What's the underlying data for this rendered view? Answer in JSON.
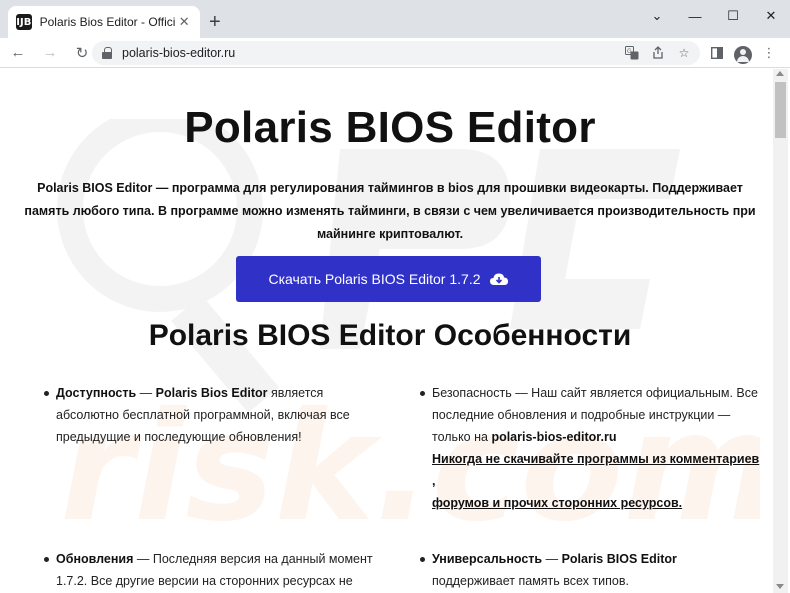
{
  "browser": {
    "tab_title": "Polaris Bios Editor - Official Webs",
    "tab_favicon_text": "ĲB",
    "url": "polaris-bios-editor.ru",
    "colors": {
      "tabbar": "#dee1e6",
      "omnibox": "#f1f3f4"
    }
  },
  "page": {
    "title": "Polaris BIOS Editor",
    "intro": "Polaris BIOS Editor — программа для регулирования таймингов в bios для прошивки видеокарты. Поддерживает память любого типа. В программе можно изменять тайминги, в связи с чем увеличивается производительность при майнинге криптовалют.",
    "download_label": "Скачать Polaris BIOS Editor 1.7.2",
    "features_title": "Polaris BIOS Editor Особенности",
    "accent_color": "#3032c7",
    "features": {
      "f1": {
        "term": "Доступность",
        "dash": " — ",
        "strong": "Polaris Bios Editor",
        "text": " является абсолютно бесплатной программной, включая все предыдущие и последующие обновления!"
      },
      "f2": {
        "text1": "Безопасность — Наш сайт является официальным. Все последние обновления и подробные инструкции — только на ",
        "strong": "polaris-bios-editor.ru",
        "warning_a": "Никогда не скачивайте программы из комментариев",
        "warning_sep": " , ",
        "warning_b": "форумов и прочих сторонних ресурсов."
      },
      "f3": {
        "term": "Обновления",
        "text": " — Последняя версия на данный момент 1.7.2. Все другие версии на сторонних ресурсах не"
      },
      "f4": {
        "term": "Универсальность",
        "dash": " — ",
        "strong": "Polaris BIOS Editor",
        "text": " поддерживает память всех типов."
      }
    }
  }
}
